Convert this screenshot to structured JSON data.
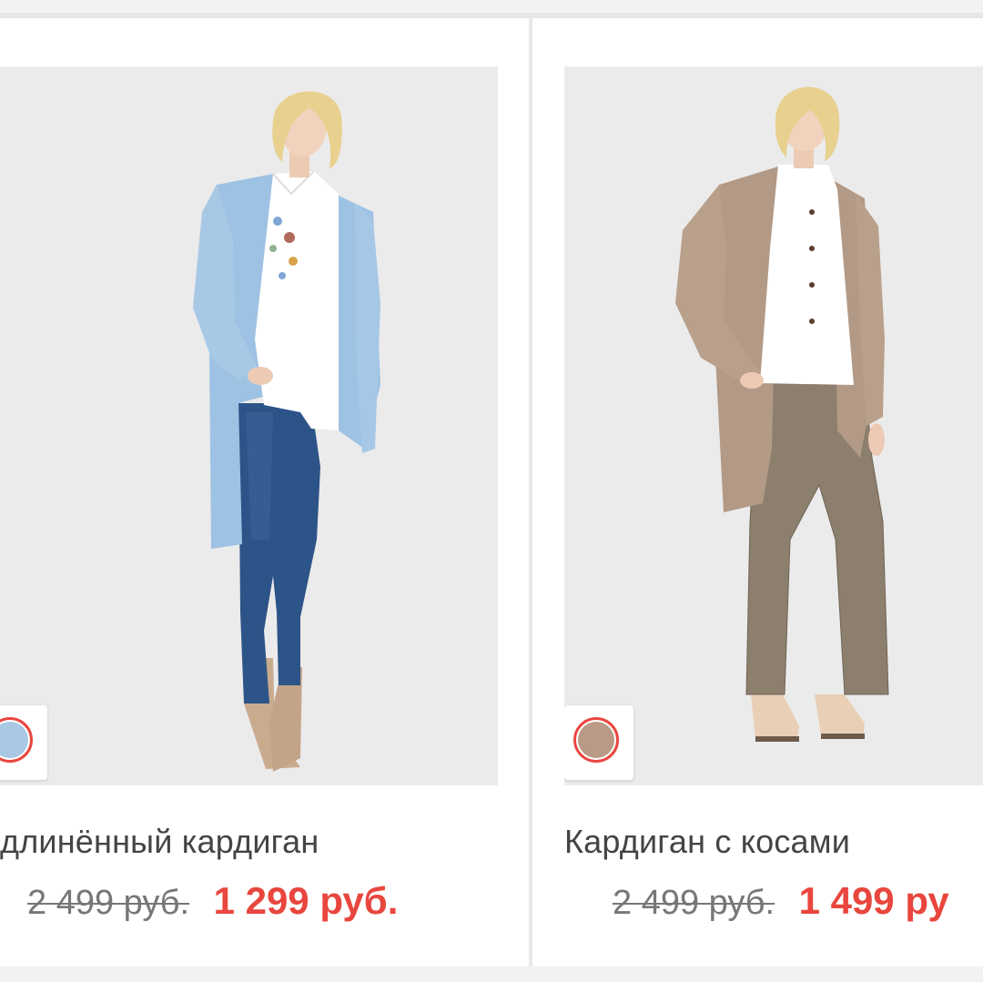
{
  "products": [
    {
      "title": "длинённый кардиган",
      "old_price": "2 499 руб.",
      "new_price": "1 299 руб.",
      "swatch_color": "#a9c8e4",
      "swatch_icon": "color-swatch-icon"
    },
    {
      "title": "Кардиган с косами",
      "old_price": "2 499 руб.",
      "new_price": "1 499 ру",
      "swatch_color": "#b89a86",
      "swatch_icon": "color-swatch-icon"
    }
  ],
  "colors": {
    "accent_red": "#e8463e",
    "photo_background": "#ebebeb",
    "text": "#444444",
    "muted_text": "#777777"
  }
}
